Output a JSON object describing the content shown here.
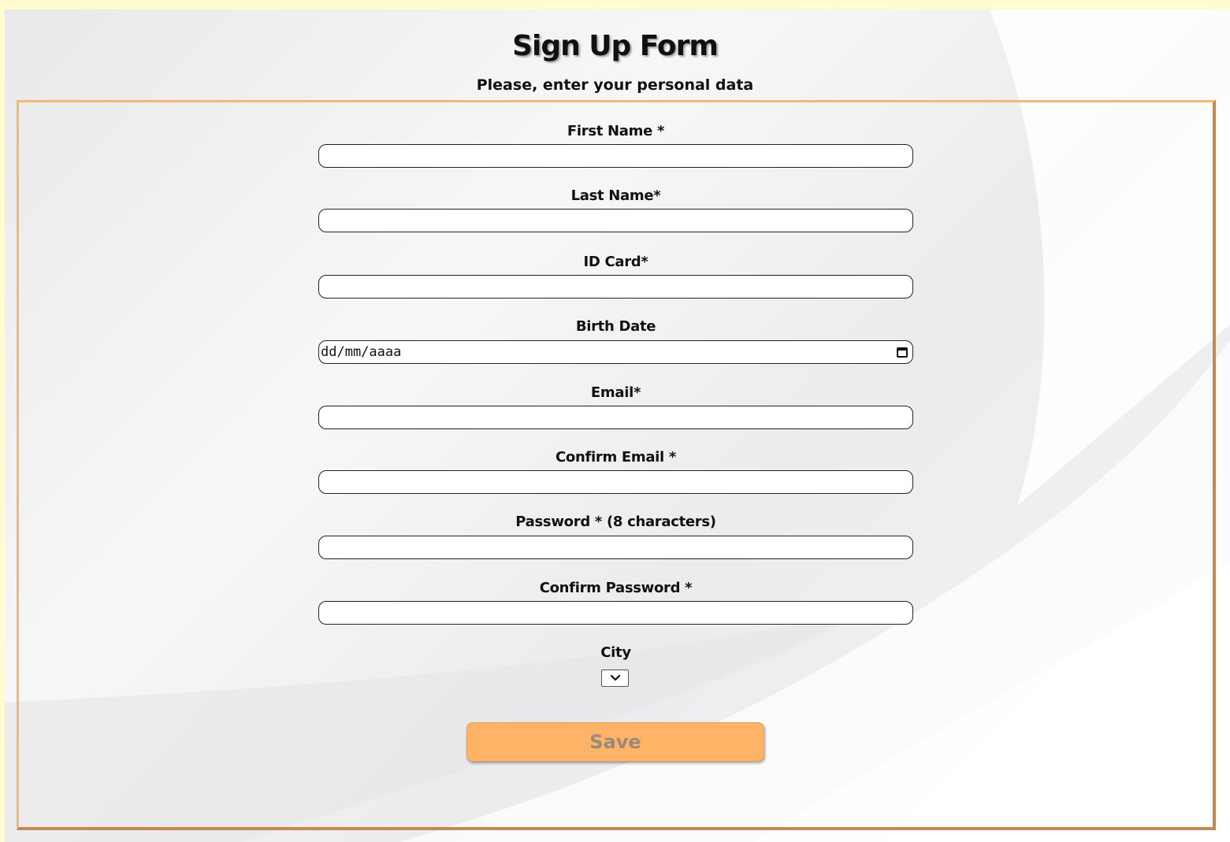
{
  "header": {
    "title": "Sign Up Form",
    "subtitle": "Please, enter your personal data"
  },
  "form": {
    "fields": [
      {
        "label": "First Name *",
        "value": ""
      },
      {
        "label": "Last Name*",
        "value": ""
      },
      {
        "label": "ID Card*",
        "value": ""
      },
      {
        "label": "Birth Date",
        "value": "",
        "placeholder": "dd/mm/aaaa"
      },
      {
        "label": "Email*",
        "value": ""
      },
      {
        "label": "Confirm Email *",
        "value": ""
      },
      {
        "label": "Password * (8 characters)",
        "value": ""
      },
      {
        "label": "Confirm Password *",
        "value": ""
      }
    ],
    "city": {
      "label": "City",
      "selected": ""
    },
    "save_label": "Save"
  },
  "colors": {
    "page_background": "#fffdd0",
    "frame_top_left": "#f5b771",
    "frame_bottom_right": "#c18a55",
    "button_background": "#ffb366",
    "button_text": "#9a8a78"
  },
  "icons": {
    "birth_date_picker": "calendar-icon",
    "city_dropdown": "chevron-down-icon"
  }
}
